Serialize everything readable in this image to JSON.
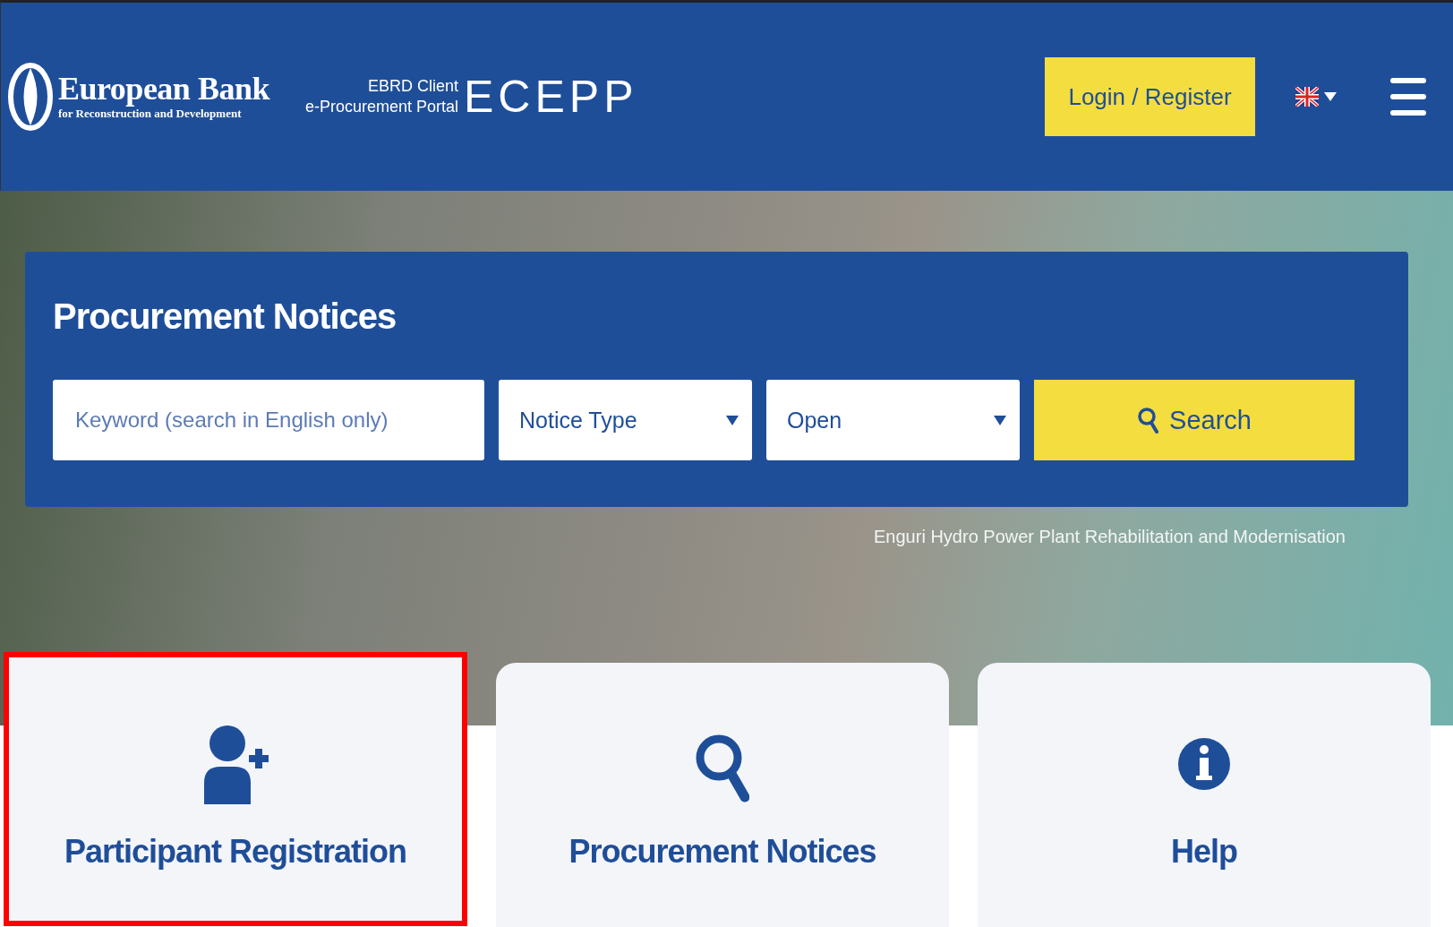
{
  "header": {
    "logo_title": "European Bank",
    "logo_subtitle": "for Reconstruction and Development",
    "portal_line_1": "EBRD Client",
    "portal_line_2": "e-Procurement Portal",
    "portal_name": "ECEPP",
    "login_button": "Login / Register"
  },
  "search_panel": {
    "title": "Procurement Notices",
    "keyword": {
      "placeholder": "Keyword (search in English only)"
    },
    "dropdowns": [
      {
        "value": "Notice Type"
      },
      {
        "value": "Open"
      }
    ],
    "search_button": "Search"
  },
  "photo_caption": "Enguri Hydro Power Plant Rehabilitation and Modernisation",
  "cards": [
    {
      "kind": "register",
      "label": "Participant Registration",
      "highlighted": true
    },
    {
      "kind": "search",
      "label": "Procurement Notices",
      "highlighted": false
    },
    {
      "kind": "info",
      "label": "Help",
      "highlighted": false
    }
  ]
}
